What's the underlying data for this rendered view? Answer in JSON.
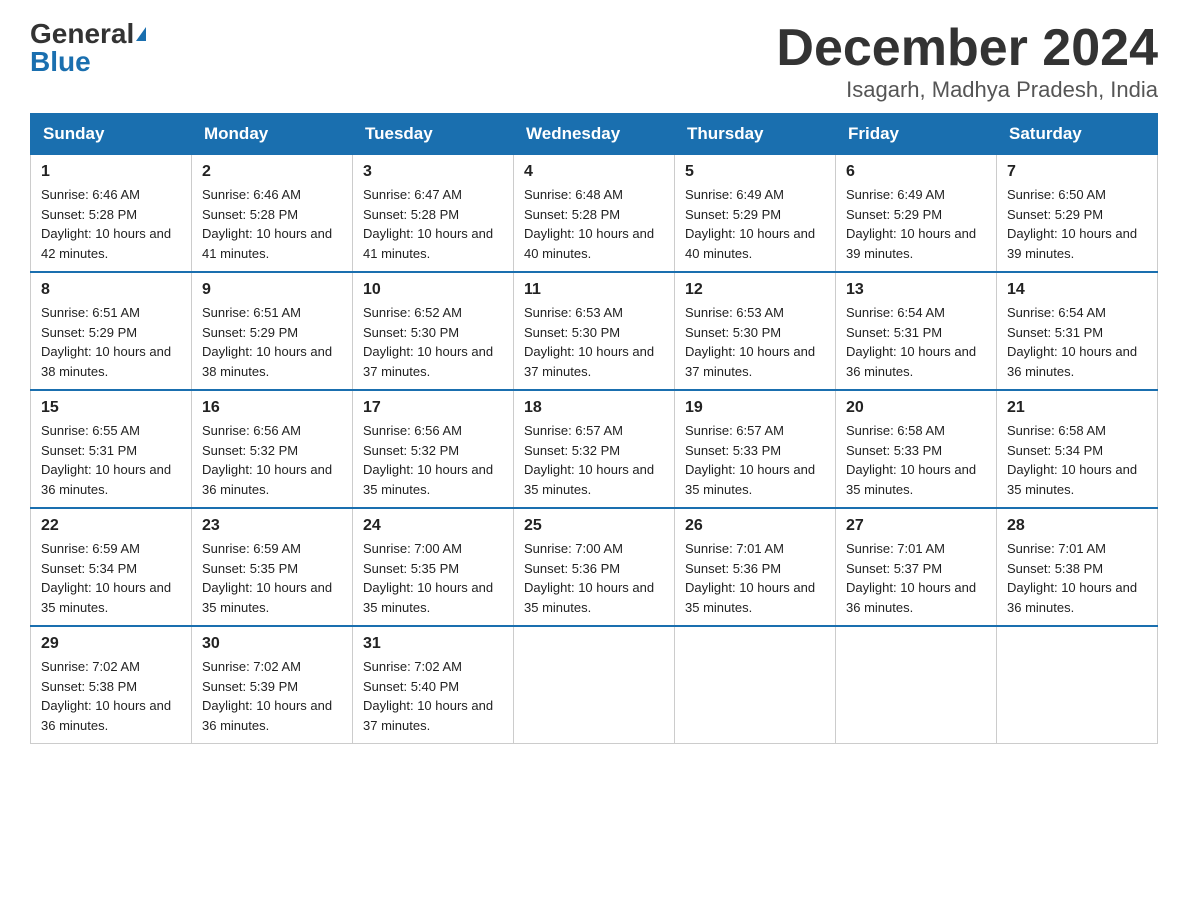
{
  "header": {
    "logo_general": "General",
    "logo_blue": "Blue",
    "month_title": "December 2024",
    "location": "Isagarh, Madhya Pradesh, India"
  },
  "days_of_week": [
    "Sunday",
    "Monday",
    "Tuesday",
    "Wednesday",
    "Thursday",
    "Friday",
    "Saturday"
  ],
  "weeks": [
    [
      {
        "day": "1",
        "sunrise": "6:46 AM",
        "sunset": "5:28 PM",
        "daylight": "10 hours and 42 minutes."
      },
      {
        "day": "2",
        "sunrise": "6:46 AM",
        "sunset": "5:28 PM",
        "daylight": "10 hours and 41 minutes."
      },
      {
        "day": "3",
        "sunrise": "6:47 AM",
        "sunset": "5:28 PM",
        "daylight": "10 hours and 41 minutes."
      },
      {
        "day": "4",
        "sunrise": "6:48 AM",
        "sunset": "5:28 PM",
        "daylight": "10 hours and 40 minutes."
      },
      {
        "day": "5",
        "sunrise": "6:49 AM",
        "sunset": "5:29 PM",
        "daylight": "10 hours and 40 minutes."
      },
      {
        "day": "6",
        "sunrise": "6:49 AM",
        "sunset": "5:29 PM",
        "daylight": "10 hours and 39 minutes."
      },
      {
        "day": "7",
        "sunrise": "6:50 AM",
        "sunset": "5:29 PM",
        "daylight": "10 hours and 39 minutes."
      }
    ],
    [
      {
        "day": "8",
        "sunrise": "6:51 AM",
        "sunset": "5:29 PM",
        "daylight": "10 hours and 38 minutes."
      },
      {
        "day": "9",
        "sunrise": "6:51 AM",
        "sunset": "5:29 PM",
        "daylight": "10 hours and 38 minutes."
      },
      {
        "day": "10",
        "sunrise": "6:52 AM",
        "sunset": "5:30 PM",
        "daylight": "10 hours and 37 minutes."
      },
      {
        "day": "11",
        "sunrise": "6:53 AM",
        "sunset": "5:30 PM",
        "daylight": "10 hours and 37 minutes."
      },
      {
        "day": "12",
        "sunrise": "6:53 AM",
        "sunset": "5:30 PM",
        "daylight": "10 hours and 37 minutes."
      },
      {
        "day": "13",
        "sunrise": "6:54 AM",
        "sunset": "5:31 PM",
        "daylight": "10 hours and 36 minutes."
      },
      {
        "day": "14",
        "sunrise": "6:54 AM",
        "sunset": "5:31 PM",
        "daylight": "10 hours and 36 minutes."
      }
    ],
    [
      {
        "day": "15",
        "sunrise": "6:55 AM",
        "sunset": "5:31 PM",
        "daylight": "10 hours and 36 minutes."
      },
      {
        "day": "16",
        "sunrise": "6:56 AM",
        "sunset": "5:32 PM",
        "daylight": "10 hours and 36 minutes."
      },
      {
        "day": "17",
        "sunrise": "6:56 AM",
        "sunset": "5:32 PM",
        "daylight": "10 hours and 35 minutes."
      },
      {
        "day": "18",
        "sunrise": "6:57 AM",
        "sunset": "5:32 PM",
        "daylight": "10 hours and 35 minutes."
      },
      {
        "day": "19",
        "sunrise": "6:57 AM",
        "sunset": "5:33 PM",
        "daylight": "10 hours and 35 minutes."
      },
      {
        "day": "20",
        "sunrise": "6:58 AM",
        "sunset": "5:33 PM",
        "daylight": "10 hours and 35 minutes."
      },
      {
        "day": "21",
        "sunrise": "6:58 AM",
        "sunset": "5:34 PM",
        "daylight": "10 hours and 35 minutes."
      }
    ],
    [
      {
        "day": "22",
        "sunrise": "6:59 AM",
        "sunset": "5:34 PM",
        "daylight": "10 hours and 35 minutes."
      },
      {
        "day": "23",
        "sunrise": "6:59 AM",
        "sunset": "5:35 PM",
        "daylight": "10 hours and 35 minutes."
      },
      {
        "day": "24",
        "sunrise": "7:00 AM",
        "sunset": "5:35 PM",
        "daylight": "10 hours and 35 minutes."
      },
      {
        "day": "25",
        "sunrise": "7:00 AM",
        "sunset": "5:36 PM",
        "daylight": "10 hours and 35 minutes."
      },
      {
        "day": "26",
        "sunrise": "7:01 AM",
        "sunset": "5:36 PM",
        "daylight": "10 hours and 35 minutes."
      },
      {
        "day": "27",
        "sunrise": "7:01 AM",
        "sunset": "5:37 PM",
        "daylight": "10 hours and 36 minutes."
      },
      {
        "day": "28",
        "sunrise": "7:01 AM",
        "sunset": "5:38 PM",
        "daylight": "10 hours and 36 minutes."
      }
    ],
    [
      {
        "day": "29",
        "sunrise": "7:02 AM",
        "sunset": "5:38 PM",
        "daylight": "10 hours and 36 minutes."
      },
      {
        "day": "30",
        "sunrise": "7:02 AM",
        "sunset": "5:39 PM",
        "daylight": "10 hours and 36 minutes."
      },
      {
        "day": "31",
        "sunrise": "7:02 AM",
        "sunset": "5:40 PM",
        "daylight": "10 hours and 37 minutes."
      },
      null,
      null,
      null,
      null
    ]
  ]
}
